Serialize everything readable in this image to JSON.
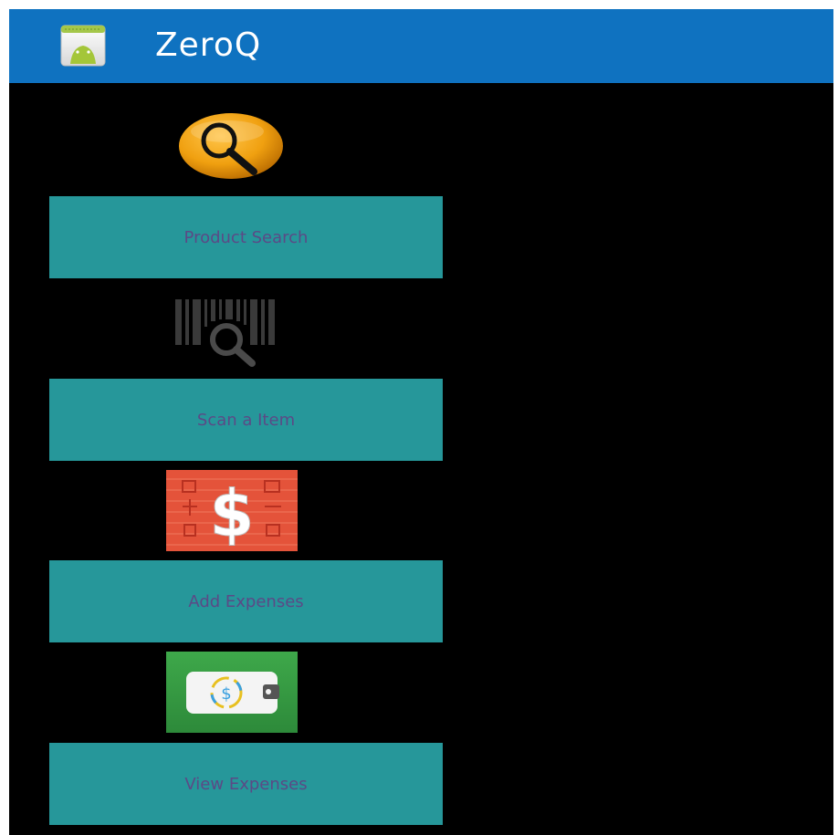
{
  "app": {
    "title": "ZeroQ",
    "icon": "android-app-icon"
  },
  "colors": {
    "action_bar": "#0f72c0",
    "background": "#000000",
    "button_bg": "#26979a",
    "button_text": "#5b4a86"
  },
  "menu": {
    "items": [
      {
        "icon": "magnifier-icon",
        "label": "Product Search"
      },
      {
        "icon": "barcode-scan-icon",
        "label": "Scan a Item"
      },
      {
        "icon": "dollar-expense-icon",
        "label": "Add Expenses"
      },
      {
        "icon": "wallet-icon",
        "label": "View Expenses"
      }
    ]
  }
}
